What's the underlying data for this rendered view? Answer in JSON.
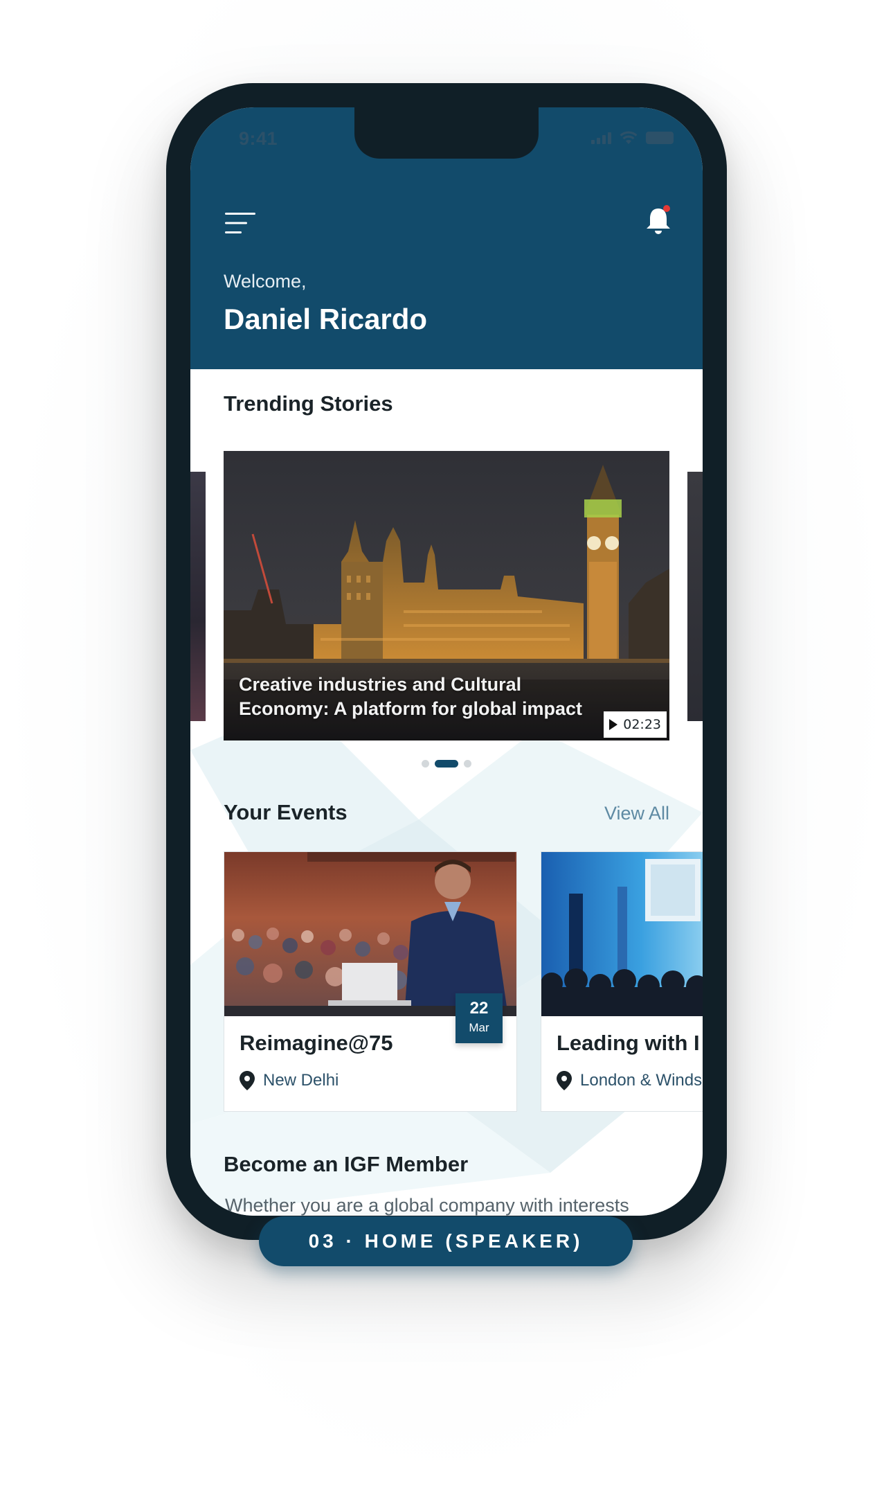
{
  "status_bar": {
    "time": "9:41"
  },
  "header": {
    "menu_icon": "hamburger-menu-icon",
    "notification_icon": "bell-icon",
    "welcome": "Welcome,",
    "user_name": "Daniel Ricardo"
  },
  "trending": {
    "title": "Trending Stories",
    "story": {
      "caption": "Creative industries and Cultural Economy: A platform for global impact",
      "duration": "02:23"
    },
    "pagination": {
      "count": 3,
      "active_index": 1
    }
  },
  "events": {
    "title": "Your Events",
    "view_all_label": "View All",
    "items": [
      {
        "title": "Reimagine@75",
        "location": "New Delhi",
        "date_day": "22",
        "date_month": "Mar"
      },
      {
        "title": "Leading with I",
        "location": "London & Winds"
      }
    ]
  },
  "membership": {
    "title": "Become an IGF Member",
    "intro": "Whether you are a global company with interests"
  },
  "caption_label": "03 · HOME (SPEAKER)",
  "colors": {
    "brand_primary": "#124b6b",
    "frame": "#101f27",
    "link": "#5e8aa3",
    "notification_dot": "#e53935"
  }
}
